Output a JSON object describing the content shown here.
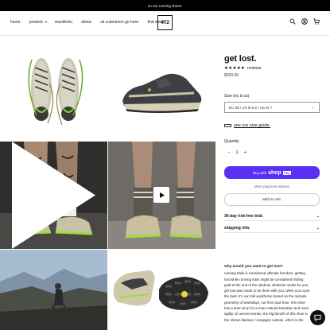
{
  "announcement": "on our running shoes.",
  "nav": {
    "items": [
      {
        "label": "home."
      },
      {
        "label": "product."
      },
      {
        "label": "manifesto."
      },
      {
        "label": "about."
      },
      {
        "label": "uk customers go here."
      },
      {
        "label": "find store."
      }
    ],
    "caret": "▾"
  },
  "logo": "4T2",
  "header_icons": [
    "search-icon",
    "account-icon",
    "cart-icon"
  ],
  "gallery": {
    "images": [
      "shoes-top-view",
      "shoe-side-view",
      "tattooed-legs-with-shoes",
      "socks-and-shoes-video",
      "trail-runner-landscape",
      "shoe-sole-view"
    ],
    "has_video_in_tile": 4
  },
  "product": {
    "title": "get lost.",
    "rating_stars": "★★★★★",
    "rating": 5,
    "reviews_label": "reviews.",
    "price": "$200.00",
    "size_label": "Size (eu & us)",
    "size_selected": "EU 38 / US M 5.5 / US W 7",
    "size_guide": "see our size guide.",
    "quantity_label": "Quantity",
    "quantity": "1",
    "qty_minus": "−",
    "qty_plus": "+",
    "buy_with": "Buy with",
    "shop": "shop",
    "pay": "Pay",
    "more_options": "More payment options",
    "add_to_cart": "add to cart.",
    "accordion": [
      {
        "label": "30-day risk-free trial.",
        "chevron": "⌄"
      },
      {
        "label": "shipping info.",
        "chevron": "⌄"
      }
    ]
  },
  "description": {
    "heading": "why would you want to get lost?",
    "lines": [
      "running trails is considered ultimate freedom. getting",
      "lost while running trails might be considered finding",
      "gold at the end of the rainbow. whatever works for you.",
      "get lost was made to be there with you, when you roam",
      "the land. it's our trail workhorse based on the midsole",
      "geometry of weekdays, our first road shoe. this shoe",
      "has a 6mm drop for a more natural transition and more",
      "agility on uneven terrain. the big benefit of this shoe is",
      "the vibram litebase / megagrip outsole, which is the"
    ]
  },
  "colors": {
    "announcement_bg": "#000000",
    "shoppay": "#5a31f4",
    "chat_bubble": "#111111"
  }
}
